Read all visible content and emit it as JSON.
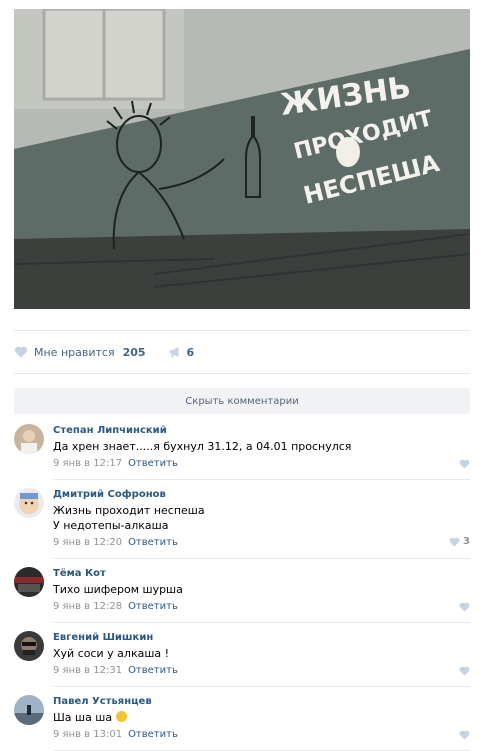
{
  "post": {
    "image_text": [
      "ЖИЗНЬ",
      "ПРОХОДИТ",
      "НЕСПЕША"
    ],
    "likes_label": "Мне нравится",
    "likes_count": "205",
    "shares_count": "6"
  },
  "comments_toggle_label": "Скрыть комментарии",
  "comments": [
    {
      "author": "Степан Липчинский",
      "lines": [
        "Да хрен знает.....я бухнул 31.12, а 04.01 проснулся"
      ],
      "date": "9 янв в 12:17",
      "reply": "Ответить",
      "likes": ""
    },
    {
      "author": "Дмитрий Софронов",
      "lines": [
        "Жизнь проходит неспеша",
        "У недотепы-алкаша"
      ],
      "date": "9 янв в 12:20",
      "reply": "Ответить",
      "likes": "3"
    },
    {
      "author": "Тёма Кот",
      "lines": [
        "Тихо шифером шурша"
      ],
      "date": "9 янв в 12:28",
      "reply": "Ответить",
      "likes": ""
    },
    {
      "author": "Евгений Шишкин",
      "lines": [
        "Хуй соси у алкаша !"
      ],
      "date": "9 янв в 12:31",
      "reply": "Ответить",
      "likes": ""
    },
    {
      "author": "Павел Устьянцев",
      "lines": [
        "Ша ша ша"
      ],
      "date": "9 янв в 13:01",
      "reply": "Ответить",
      "likes": ""
    }
  ],
  "colors": {
    "link": "#2a5885",
    "meta": "#939393",
    "divider": "#e7e8ec",
    "button_bg": "#f0f2f5"
  }
}
